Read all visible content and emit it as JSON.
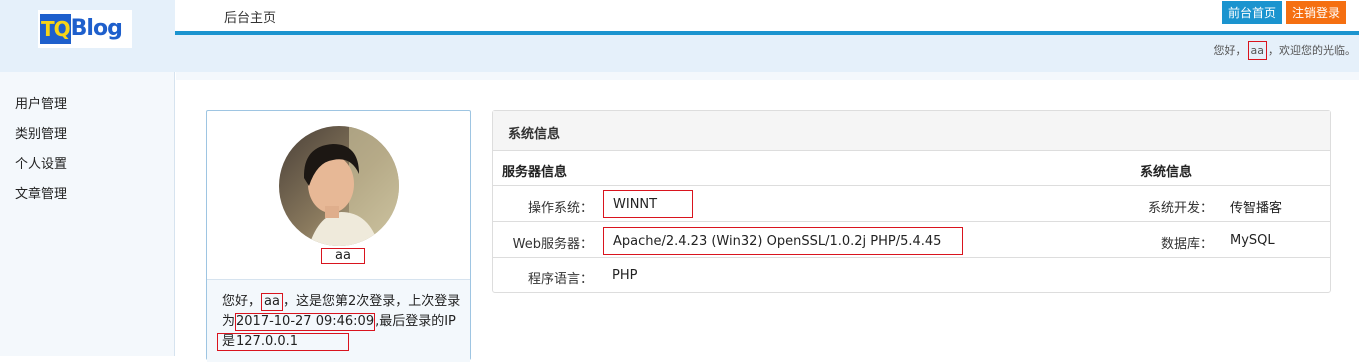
{
  "header": {
    "logo_tq": "TQ",
    "logo_blog": "Blog",
    "title": "后台主页",
    "btn_front": "前台首页",
    "btn_logout": "注销登录",
    "welcome_prefix": "您好，",
    "welcome_user": "aa",
    "welcome_suffix": "，欢迎您的光临。"
  },
  "sidebar": {
    "items": [
      {
        "label": "用户管理"
      },
      {
        "label": "类别管理"
      },
      {
        "label": "个人设置"
      },
      {
        "label": "文章管理"
      }
    ]
  },
  "profile": {
    "name": "aa",
    "text_1": "您好，",
    "user": "aa",
    "text_2": "，这是您第2次登录，上次登录为",
    "last_login": "2017-10-27 09:46:09",
    "text_3": ",最后登录的IP是",
    "ip": "127.0.0.1"
  },
  "sysinfo": {
    "title": "系统信息",
    "col_server": "服务器信息",
    "col_system": "系统信息",
    "rows": [
      {
        "label": "操作系统：",
        "value": "WINNT",
        "label2": "系统开发：",
        "value2": "传智播客"
      },
      {
        "label": "Web服务器：",
        "value": "Apache/2.4.23 (Win32) OpenSSL/1.0.2j PHP/5.4.45",
        "label2": "数据库：",
        "value2": "MySQL"
      },
      {
        "label": "程序语言：",
        "value": "PHP"
      }
    ]
  },
  "colors": {
    "accent_blue": "#1b94cf",
    "logout_orange": "#f56f11",
    "highlight_red": "#d9141e"
  }
}
